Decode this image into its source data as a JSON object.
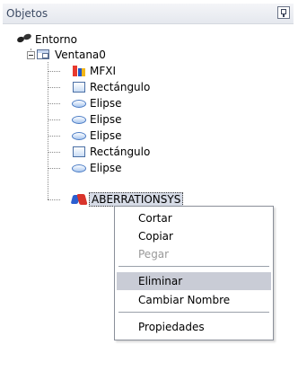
{
  "panel": {
    "title": "Objetos"
  },
  "tree": {
    "root": {
      "label": "Entorno",
      "icon": "glasses-icon"
    },
    "window": {
      "label": "Ventana0",
      "icon": "window-icon"
    },
    "children": [
      {
        "label": "MFXI",
        "icon": "mfxi-icon"
      },
      {
        "label": "Rectángulo",
        "icon": "rectangle-icon"
      },
      {
        "label": "Elipse",
        "icon": "ellipse-icon"
      },
      {
        "label": "Elipse",
        "icon": "ellipse-icon"
      },
      {
        "label": "Elipse",
        "icon": "ellipse-icon"
      },
      {
        "label": "Rectángulo",
        "icon": "rectangle-icon"
      },
      {
        "label": "Elipse",
        "icon": "ellipse-icon"
      },
      {
        "label": "ABERRATIONSYS",
        "icon": "aberration-icon",
        "selected": true
      }
    ]
  },
  "context_menu": {
    "items": [
      {
        "label": "Cortar",
        "enabled": true
      },
      {
        "label": "Copiar",
        "enabled": true
      },
      {
        "label": "Pegar",
        "enabled": false
      },
      {
        "label": "Eliminar",
        "enabled": true,
        "highlighted": true
      },
      {
        "label": "Cambiar Nombre",
        "enabled": true
      },
      {
        "label": "Propiedades",
        "enabled": true
      }
    ]
  },
  "colors": {
    "header_text": "#3c4a63",
    "menu_highlight": "#c9ccd6",
    "disabled_text": "#9a9a9a"
  }
}
